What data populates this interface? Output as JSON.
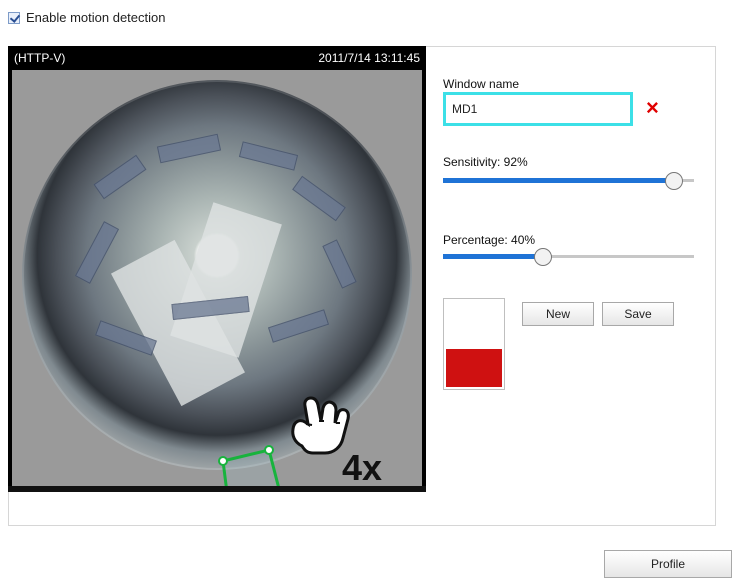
{
  "topbar": {
    "enable_label": "Enable motion detection"
  },
  "video": {
    "stream_label": "(HTTP-V)",
    "timestamp": "2011/7/14 13:11:45",
    "zoom_overlay": "4x"
  },
  "form": {
    "window_name_label": "Window name",
    "window_name_value": "MD1",
    "sensitivity_label": "Sensitivity: 92%",
    "sensitivity_value": 92,
    "percentage_label": "Percentage: 40%",
    "percentage_value": 40,
    "new_button": "New",
    "save_button": "Save"
  },
  "footer": {
    "profile_button": "Profile"
  },
  "icons": {
    "remove": "close-icon",
    "gesture": "hand-icon"
  },
  "colors": {
    "input_border": "#3ce0e7",
    "slider_fill": "#1f73d6",
    "preview_red": "#cf1111",
    "region_green": "#18b33d"
  }
}
